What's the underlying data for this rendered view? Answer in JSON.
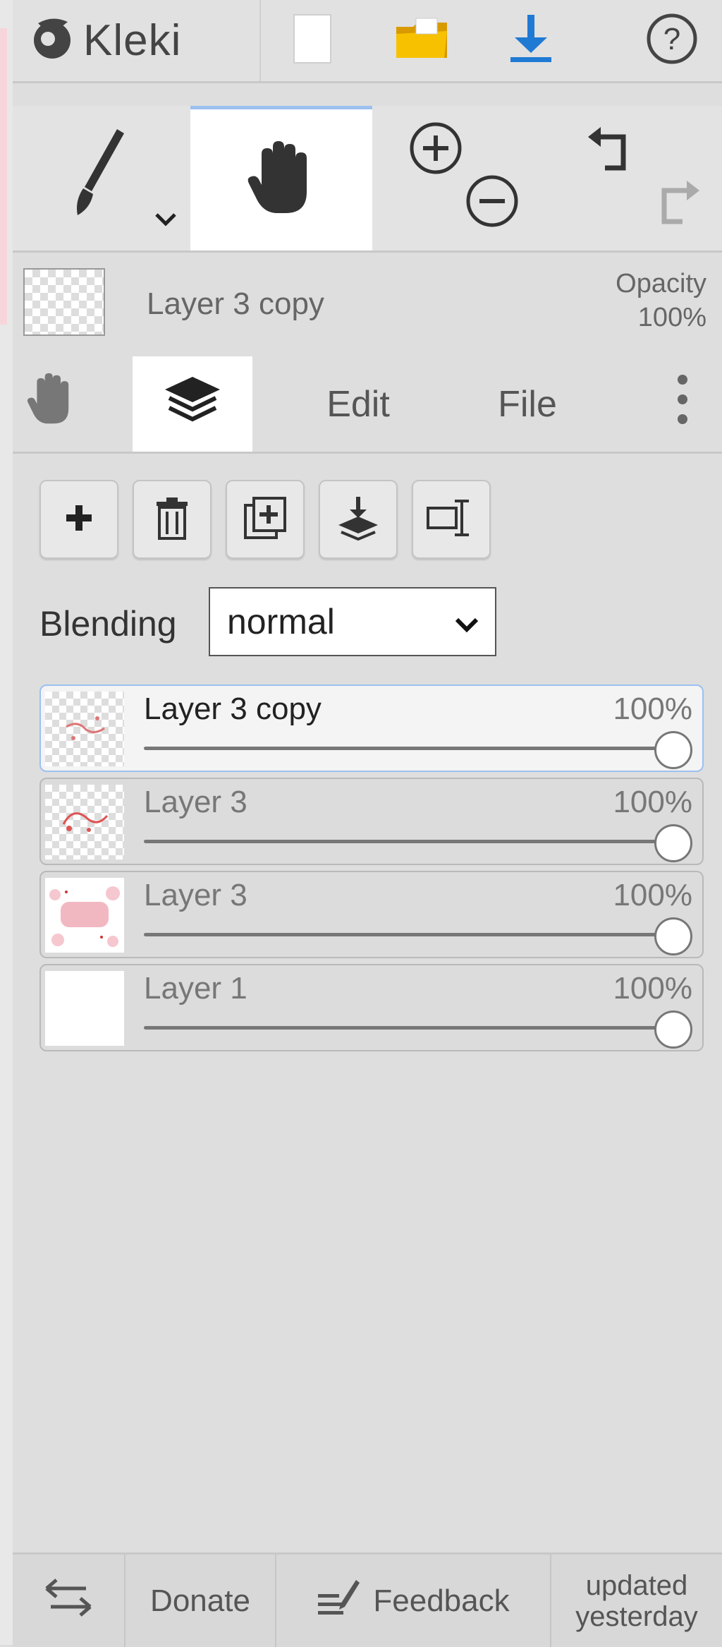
{
  "app": {
    "brand": "Kleki"
  },
  "top_toolbar": {
    "icons": [
      "kleki-logo-icon",
      "new-file-icon",
      "open-folder-icon",
      "download-icon",
      "help-icon"
    ],
    "colors": {
      "folder": "#f0b400",
      "download": "#1f7ad4"
    }
  },
  "tool_row": {
    "icons": [
      "brush-icon",
      "hand-icon",
      "zoom-in-icon",
      "zoom-out-icon",
      "undo-icon",
      "redo-icon"
    ],
    "active_tool": "hand"
  },
  "current_layer": {
    "name": "Layer 3 copy",
    "opacity_label": "Opacity",
    "opacity_value": "100%"
  },
  "tabs": {
    "edit": "Edit",
    "file": "File",
    "active": "layers"
  },
  "layer_actions": {
    "icons": [
      "add-layer-icon",
      "delete-layer-icon",
      "duplicate-layer-icon",
      "merge-down-icon",
      "rename-layer-icon"
    ]
  },
  "blending": {
    "label": "Blending",
    "value": "normal"
  },
  "layers": [
    {
      "name": "Layer 3 copy",
      "opacity": "100%",
      "selected": true
    },
    {
      "name": "Layer 3",
      "opacity": "100%",
      "selected": false
    },
    {
      "name": "Layer 3",
      "opacity": "100%",
      "selected": false
    },
    {
      "name": "Layer 1",
      "opacity": "100%",
      "selected": false
    }
  ],
  "bottom_bar": {
    "donate": "Donate",
    "feedback": "Feedback",
    "updated_line1": "updated",
    "updated_line2": "yesterday"
  }
}
